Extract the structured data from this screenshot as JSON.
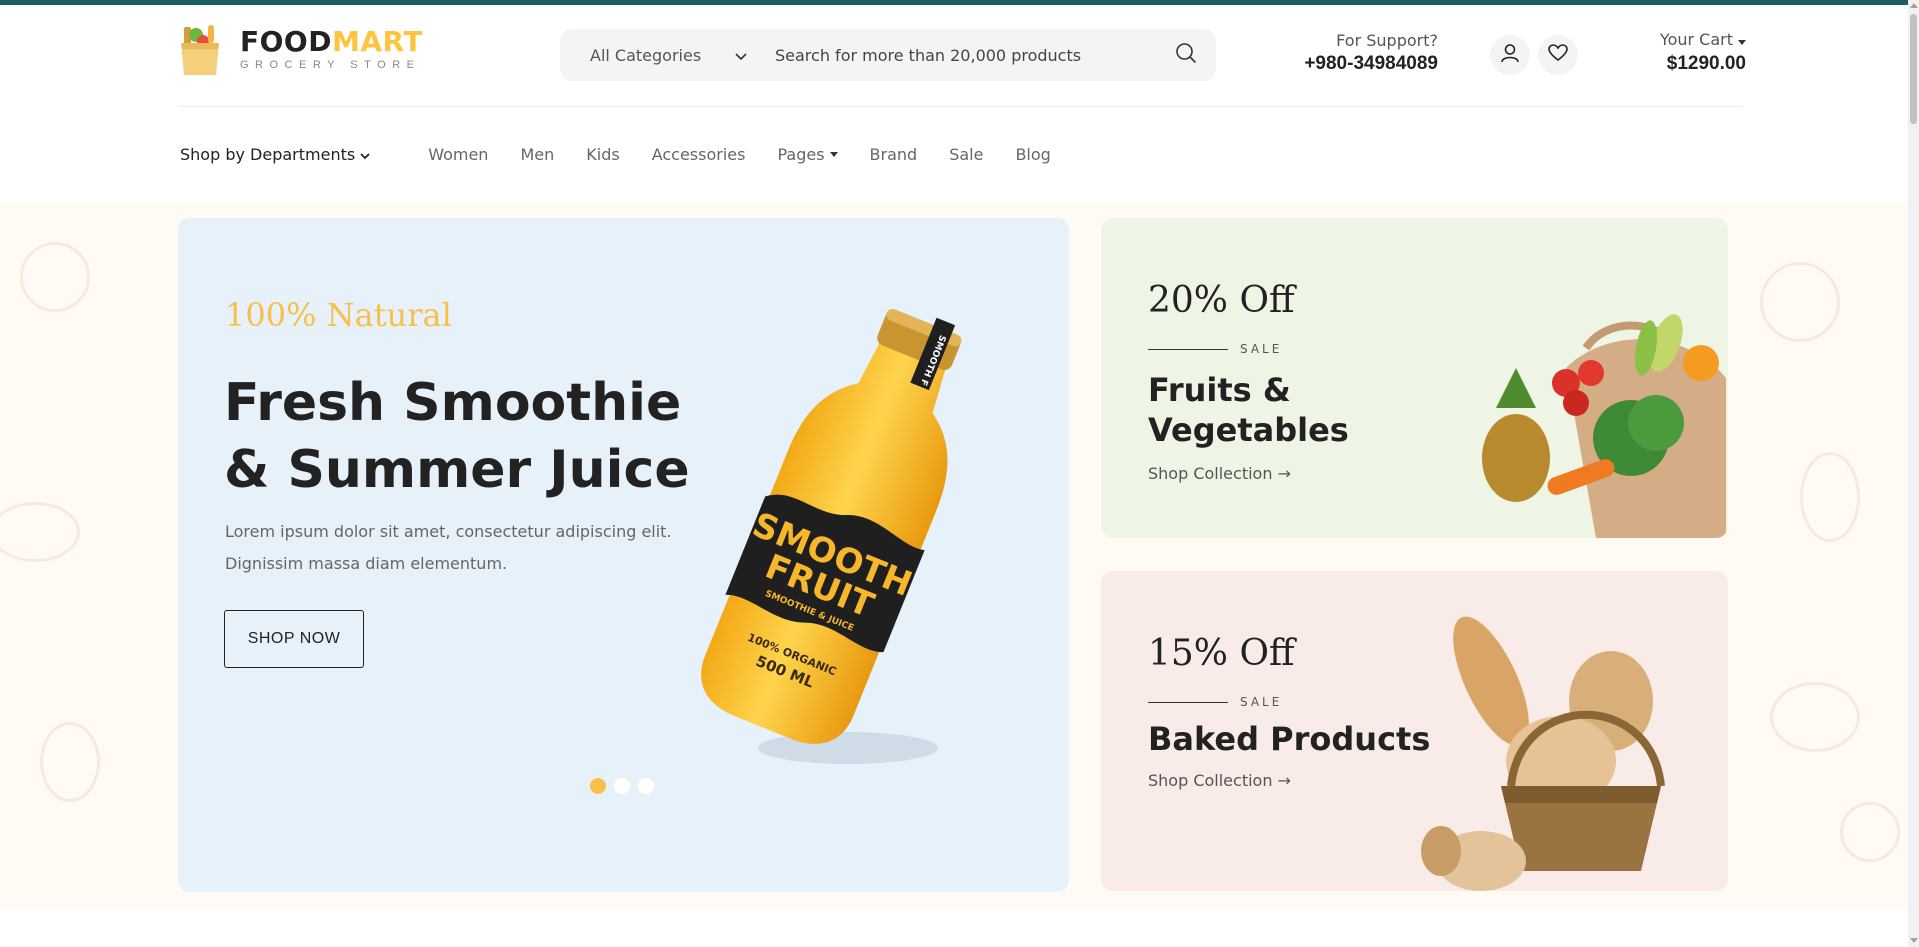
{
  "brand": {
    "name_part1": "FOOD",
    "name_part2": "MART",
    "tagline": "GROCERY STORE",
    "colors": {
      "gold": "#ffc43f",
      "teal_strip": "#1c5f63"
    }
  },
  "search": {
    "category": "All Categories",
    "placeholder": "Search for more than 20,000 products",
    "icon": "search-icon"
  },
  "support": {
    "label": "For Support?",
    "phone": "+980-34984089"
  },
  "account_icons": [
    "user-icon",
    "heart-icon"
  ],
  "cart": {
    "label": "Your Cart",
    "total": "$1290.00"
  },
  "nav": {
    "departments": "Shop by Departments",
    "items": [
      "Women",
      "Men",
      "Kids",
      "Accessories",
      "Pages",
      "Brand",
      "Sale",
      "Blog"
    ]
  },
  "hero": {
    "eyebrow": "100% Natural",
    "headline": "Fresh Smoothie & Summer Juice",
    "body": "Lorem ipsum dolor sit amet, consectetur adipiscing elit. Dignissim massa diam elementum.",
    "cta": "SHOP NOW",
    "bottle": {
      "label_line1": "SMOOTH",
      "label_line2": "FRUIT",
      "label_sub": "SMOOTHIE & JUICE",
      "organic": "100% ORGANIC",
      "volume": "500 ML",
      "cap": "SMOOTH F"
    },
    "slides": 3,
    "active_slide": 1
  },
  "promos": [
    {
      "discount": "20% Off",
      "sale": "SALE",
      "title": "Fruits & Vegetables",
      "link": "Shop Collection →",
      "bg": "#eef5e4"
    },
    {
      "discount": "15% Off",
      "sale": "SALE",
      "title": "Baked Products",
      "link": "Shop Collection →",
      "bg": "#f9ebe7"
    }
  ]
}
